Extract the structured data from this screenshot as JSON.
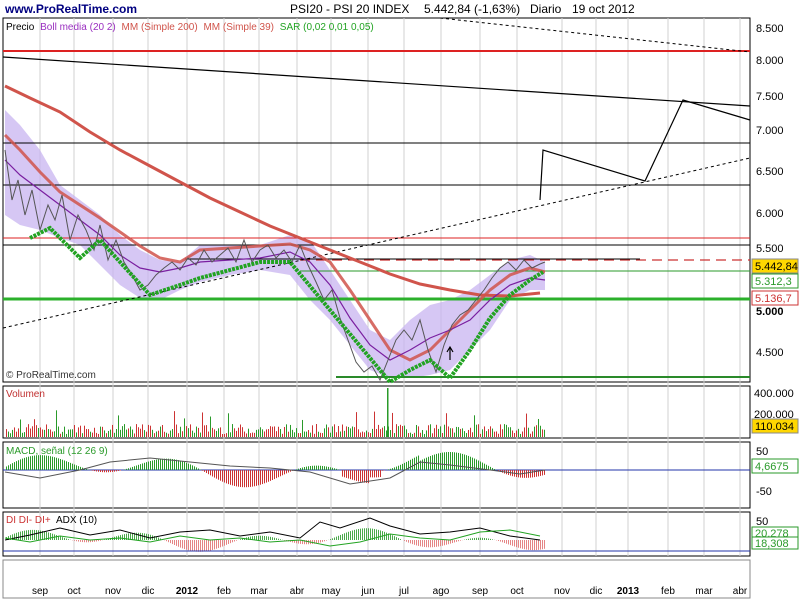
{
  "header": {
    "site": "www.ProRealTime.com",
    "title": "PSI20 - PSI 20 INDEX",
    "quote": "5.442,84 (-1,63%)",
    "period": "Diario",
    "date": "19 oct 2012"
  },
  "price_panel": {
    "legend": [
      {
        "text": "Precio",
        "color": "#000000"
      },
      {
        "text": "Boll media (20 2)",
        "color": "#9a2fc0"
      },
      {
        "text": "MM (Simple 200)",
        "color": "#d0544b"
      },
      {
        "text": "MM (Simple 39)",
        "color": "#d0544b"
      },
      {
        "text": "SAR (0,02 0,01 0,05)",
        "color": "#22a322"
      }
    ],
    "watermark": "© ProRealTime.com",
    "y_ticks": [
      "8.500",
      "8.000",
      "7.500",
      "7.000",
      "6.500",
      "6.000",
      "5.500",
      "5.000",
      "4.500"
    ],
    "badges": [
      {
        "text": "5.442,84",
        "bg": "#ffd700",
        "fg": "#000000",
        "value": 5442.84
      },
      {
        "text": "5.312,3",
        "bg": "#ffffff",
        "fg": "#2a9a2a",
        "value": 5312.3
      },
      {
        "text": "5.136,7",
        "bg": "#ffffff",
        "fg": "#cc3333",
        "value": 5136.7
      }
    ]
  },
  "volume_panel": {
    "label": "Volumen",
    "y_ticks": [
      "400.000",
      "200.000"
    ],
    "badge": "110.034"
  },
  "macd_panel": {
    "label": "MACD, señal (12 26 9)",
    "y_ticks": [
      "50",
      "-50"
    ],
    "badge": "4,6675"
  },
  "adx_panel": {
    "label_prefix": "DI DI- DI+",
    "label_suffix": "ADX (10)",
    "y_ticks": [
      "50"
    ],
    "badge_top": "20,278",
    "badge_bottom": "18,308"
  },
  "x_axis": {
    "labels": [
      "sep",
      "oct",
      "nov",
      "dic",
      "2012",
      "feb",
      "mar",
      "abr",
      "may",
      "jun",
      "jul",
      "ago",
      "sep",
      "oct",
      "nov",
      "dic",
      "2013",
      "feb",
      "mar",
      "abr"
    ]
  },
  "chart_data": {
    "type": "line",
    "title": "PSI20 - PSI 20 INDEX",
    "x": [
      "sep 2011",
      "oct 2011",
      "nov 2011",
      "dic 2011",
      "ene 2012",
      "feb 2012",
      "mar 2012",
      "abr 2012",
      "may 2012",
      "jun 2012",
      "jul 2012",
      "ago 2012",
      "sep 2012",
      "oct 2012"
    ],
    "ylim": [
      4300,
      8700
    ],
    "series": [
      {
        "name": "Precio",
        "color": "#555555",
        "values": [
          6550,
          5800,
          5400,
          5150,
          5400,
          5520,
          5500,
          5550,
          5050,
          4450,
          4550,
          4700,
          5350,
          5443
        ]
      },
      {
        "name": "Boll media (20 2)",
        "color": "#9a2fc0",
        "values": [
          6700,
          6050,
          5600,
          5200,
          5250,
          5450,
          5450,
          5500,
          5150,
          4700,
          4550,
          4650,
          5100,
          5312
        ]
      },
      {
        "name": "MM (Simple 200)",
        "color": "#d0544b",
        "values": [
          7550,
          7200,
          6900,
          6650,
          6400,
          6150,
          5950,
          5750,
          5550,
          5400,
          5250,
          5150,
          5120,
          5137
        ]
      },
      {
        "name": "MM (Simple 39)",
        "color": "#d0544b",
        "values": [
          7000,
          6300,
          5850,
          5450,
          5250,
          5400,
          5500,
          5500,
          5350,
          4950,
          4650,
          4750,
          4950,
          5300
        ]
      },
      {
        "name": "SAR (0,02 0,01 0,05)",
        "color": "#22a322",
        "values": [
          5900,
          5600,
          5300,
          5100,
          5200,
          5380,
          5400,
          5420,
          5600,
          5100,
          4400,
          4450,
          4950,
          5250
        ]
      }
    ],
    "horizontal_levels": [
      8120,
      6850,
      6330,
      5720,
      5640,
      5450,
      5380,
      5100,
      4410
    ],
    "volume": [
      250000,
      230000,
      210000,
      260000,
      220000,
      210000,
      260000,
      200000,
      280000,
      300000,
      250000,
      180000,
      230000,
      110034
    ],
    "macd": [
      -30,
      -20,
      10,
      20,
      15,
      10,
      5,
      -5,
      -35,
      -30,
      40,
      30,
      20,
      4.67
    ],
    "adx": [
      22,
      28,
      25,
      22,
      20,
      26,
      24,
      23,
      38,
      40,
      33,
      25,
      28,
      20.28
    ],
    "grid": true
  }
}
